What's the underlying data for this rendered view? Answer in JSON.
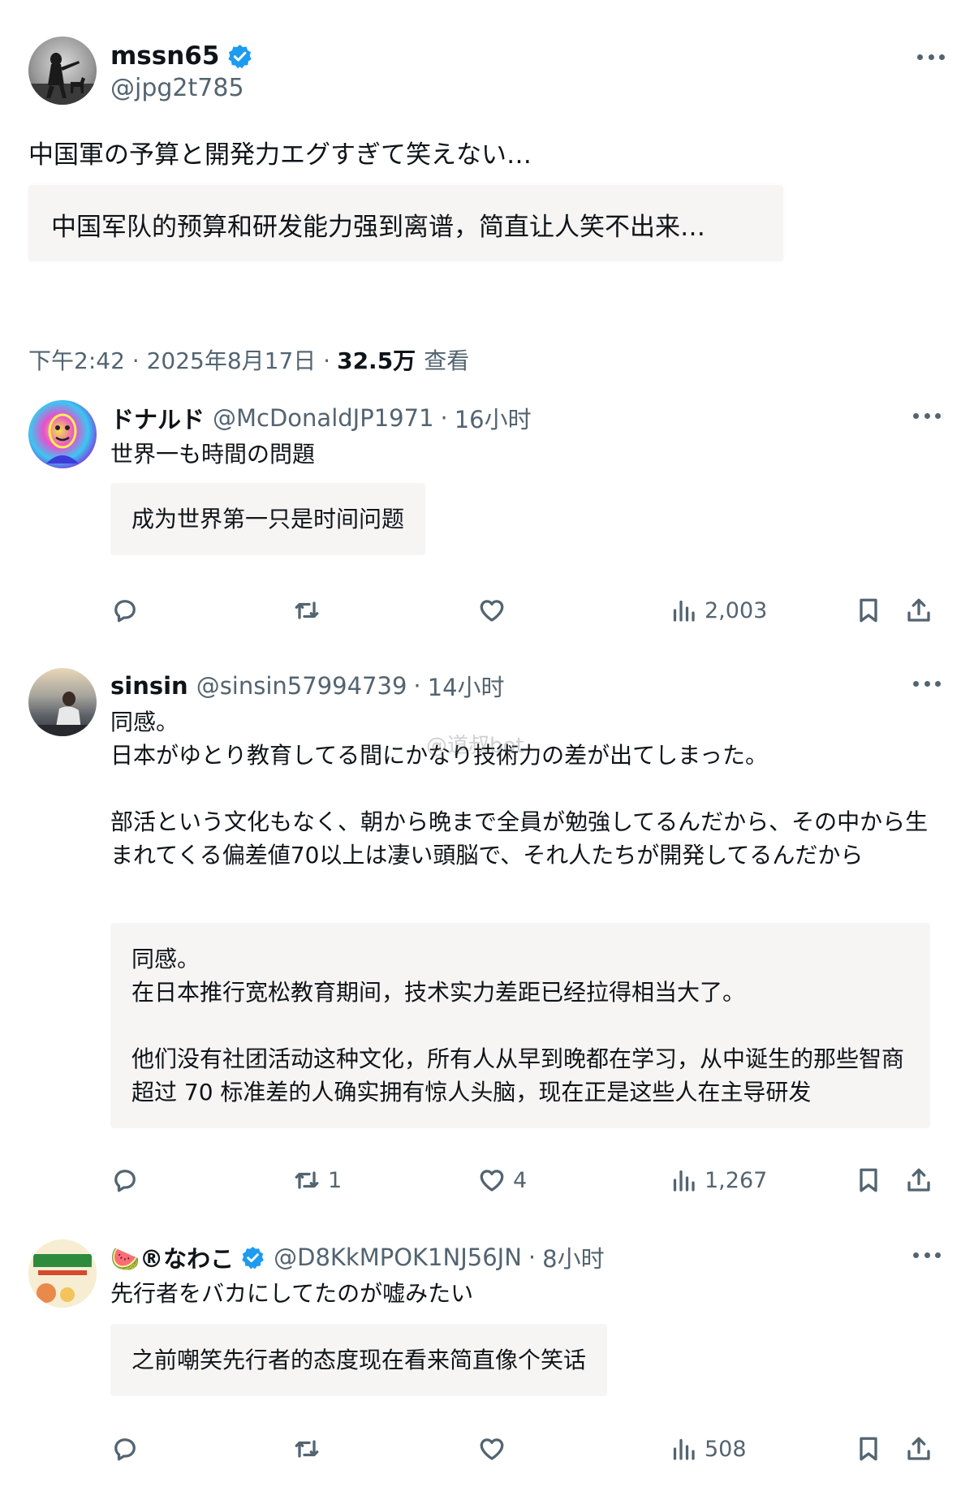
{
  "post": {
    "name": "mssn65",
    "handle": "@jpg2t785",
    "text": "中国軍の予算と開発力エグすぎて笑えない…",
    "translation": "中国军队的预算和研发能力强到离谱，简直让人笑不出来…",
    "time": "下午2:42 · 2025年8月17日 ·",
    "views": "32.5万",
    "views_label": "查看"
  },
  "replies": [
    {
      "name": "ドナルド",
      "handle": "@McDonaldJP1971",
      "time": "16小时",
      "text": "世界一も時間の問題",
      "translation": "成为世界第一只是时间问题",
      "retweets": "",
      "likes": "",
      "views": "2,003"
    },
    {
      "name": "sinsin",
      "handle": "@sinsin57994739",
      "time": "14小时",
      "text": "同感。\n日本がゆとり教育してる間にかなり技術力の差が出てしまった。\n\n部活という文化もなく、朝から晩まで全員が勉強してるんだから、その中から生まれてくる偏差値70以上は凄い頭脳で、それ人たちが開発してるんだから",
      "translation": "同感。\n在日本推行宽松教育期间，技术实力差距已经拉得相当大了。\n\n他们没有社团活动这种文化，所有人从早到晚都在学习，从中诞生的那些智商超过 70 标准差的人确实拥有惊人头脑，现在正是这些人在主导研发",
      "retweets": "1",
      "likes": "4",
      "views": "1,267"
    },
    {
      "name": "🍉®なわこ",
      "handle": "@D8KkMPOK1NJ56JN",
      "time": "8小时",
      "text": "先行者をバカにしてたのが嘘みたい",
      "translation": "之前嘲笑先行者的态度现在看来简直像个笑话",
      "retweets": "",
      "likes": "",
      "views": "508"
    }
  ],
  "watermark": "@道叔bot",
  "colors": {
    "text": "#0f1419",
    "secondary": "#536471",
    "verified": "#1d9bf0",
    "translation_bg": "#f7f5f4"
  },
  "icons": [
    "more-icon",
    "verified-icon",
    "reply-icon",
    "retweet-icon",
    "like-icon",
    "views-icon",
    "bookmark-icon",
    "share-icon"
  ]
}
